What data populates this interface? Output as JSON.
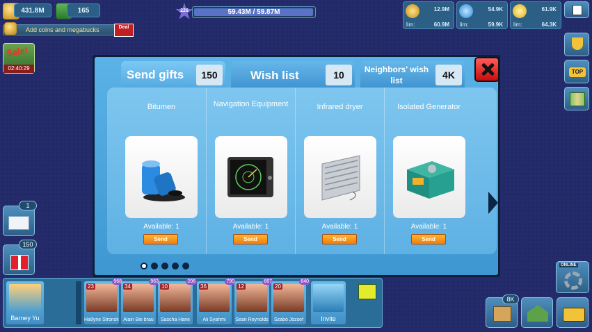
{
  "top_resources": {
    "coins": "431.8M",
    "megabucks": "165",
    "add_coins_label": "Add coins and megabucks",
    "deal_label": "Deal"
  },
  "experience": {
    "level": "226",
    "progress_text": "59.43M / 59.87M",
    "progress": 0.993
  },
  "stats": [
    {
      "value": "12.9M",
      "limit_label": "lim:",
      "limit": "60.9M",
      "icon": "population-icon"
    },
    {
      "value": "54.9K",
      "limit_label": "lim:",
      "limit": "59.9K",
      "icon": "water-icon"
    },
    {
      "value": "61.9K",
      "limit_label": "lim:",
      "limit": "64.3K",
      "icon": "energy-icon"
    }
  ],
  "sale": {
    "label": "Sale!",
    "timer": "02:40:29"
  },
  "modal": {
    "tabs": [
      {
        "label": "Send gifts",
        "count": "150"
      },
      {
        "label": "Wish list",
        "count": "10"
      },
      {
        "label": "Neighbors' wish list",
        "count": "4K"
      }
    ],
    "items": [
      {
        "name": "Bitumen",
        "availability": "Available: 1",
        "send_label": "Send",
        "icon": "bitumen-barrels-icon"
      },
      {
        "name": "Navigation Equipment",
        "availability": "Available: 1",
        "send_label": "Send",
        "icon": "radar-screen-icon"
      },
      {
        "name": "Infrared dryer",
        "availability": "Available: 1",
        "send_label": "Send",
        "icon": "radiator-icon"
      },
      {
        "name": "Isolated Generator",
        "availability": "Available: 1",
        "send_label": "Send",
        "icon": "generator-icon"
      }
    ]
  },
  "mail_count": "1",
  "gift_count": "150",
  "friends": {
    "me": "Barney Yu",
    "slots": [
      {
        "level": "23",
        "badge": "968",
        "name": "Ha8yne Stronskin"
      },
      {
        "level": "34",
        "badge": "963",
        "name": "Alain Bie brau"
      },
      {
        "level": "10",
        "badge": "206",
        "name": "Sascha Hane"
      },
      {
        "level": "36",
        "badge": "790",
        "name": "Ali Syahmi"
      },
      {
        "level": "12",
        "badge": "667",
        "name": "Sean Reynolds"
      },
      {
        "level": "20",
        "badge": "640",
        "name": "Szabó József"
      }
    ],
    "invite_label": "Invite"
  },
  "bottom_right": {
    "online_label": "ONLINE",
    "market_badge": "8K"
  },
  "colors": {
    "background": "#232a6a",
    "panel": "#4fa6df",
    "send_button": "#f7931a",
    "close_button": "#e02020"
  }
}
